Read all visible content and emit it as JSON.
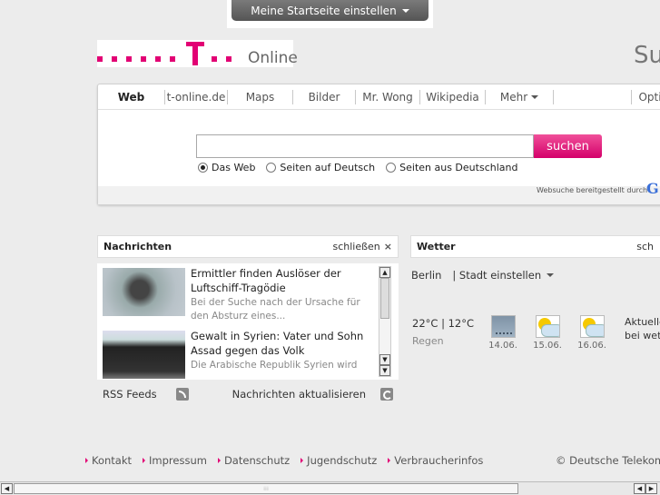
{
  "top_tab": {
    "label": "Meine Startseite einstellen"
  },
  "logo": {
    "text": "Online"
  },
  "brand_right": "Su",
  "search": {
    "tabs": [
      {
        "label": "Web"
      },
      {
        "label": "t-online.de"
      },
      {
        "label": "Maps"
      },
      {
        "label": "Bilder"
      },
      {
        "label": "Mr. Wong"
      },
      {
        "label": "Wikipedia"
      },
      {
        "label": "Mehr"
      },
      {
        "label": ""
      },
      {
        "label": "Opti"
      }
    ],
    "input_value": "",
    "button_label": "suchen",
    "radios": [
      {
        "label": "Das Web",
        "checked": true
      },
      {
        "label": "Seiten auf Deutsch",
        "checked": false
      },
      {
        "label": "Seiten aus Deutschland",
        "checked": false
      }
    ],
    "provided_by": "Websuche bereitgestellt durch",
    "provider_initial": "G"
  },
  "news": {
    "title": "Nachrichten",
    "close_label": "schließen",
    "items": [
      {
        "title": "Ermittler finden Auslöser der Luftschiff-Tragödie",
        "desc": "Bei der Suche nach der Ursache für den Absturz eines..."
      },
      {
        "title": "Gewalt in Syrien: Vater und Sohn Assad gegen das Volk",
        "desc": "Die Arabische Republik Syrien wird"
      }
    ],
    "rss_label": "RSS Feeds",
    "refresh_label": "Nachrichten aktualisieren"
  },
  "weather": {
    "title": "Wetter",
    "close_label": "sch",
    "city": "Berlin",
    "city_set_label": "| Stadt einstellen",
    "temp": "22°C | 12°C",
    "desc": "Regen",
    "days": [
      {
        "date": "14.06.",
        "icon": "rain-icon"
      },
      {
        "date": "15.06.",
        "icon": "sun-cloud-icon"
      },
      {
        "date": "16.06.",
        "icon": "sun-cloud-icon"
      }
    ],
    "side_line1": "Aktuelle",
    "side_line2": "bei wett"
  },
  "footer": {
    "links": [
      {
        "label": "Kontakt"
      },
      {
        "label": "Impressum"
      },
      {
        "label": "Datenschutz"
      },
      {
        "label": "Jugendschutz"
      },
      {
        "label": "Verbraucherinfos"
      }
    ],
    "copyright": "© Deutsche Telekom"
  },
  "colors": {
    "magenta": "#e20074",
    "background": "#ececec"
  }
}
